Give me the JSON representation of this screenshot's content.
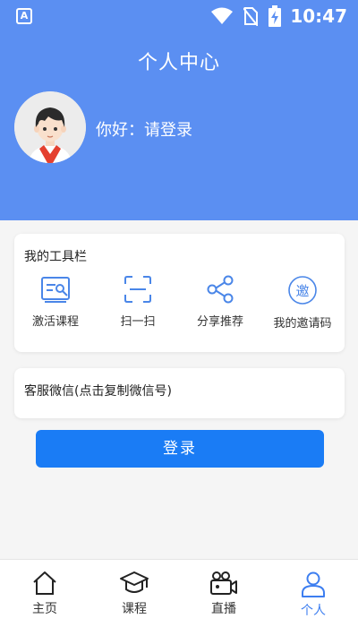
{
  "status_bar": {
    "time": "10:47",
    "app_icon_letter": "A"
  },
  "header": {
    "title": "个人中心",
    "greeting": "你好：请登录"
  },
  "toolbar": {
    "title": "我的工具栏",
    "items": [
      {
        "label": "激活课程",
        "icon": "activate-course-icon"
      },
      {
        "label": "扫一扫",
        "icon": "scan-icon"
      },
      {
        "label": "分享推荐",
        "icon": "share-icon"
      },
      {
        "label": "我的邀请码",
        "icon": "invite-code-icon"
      }
    ],
    "invite_glyph": "邀"
  },
  "service": {
    "label": "客服微信(点击复制微信号)"
  },
  "login_button": {
    "label": "登录"
  },
  "tabbar": {
    "items": [
      {
        "label": "主页",
        "icon": "home-icon"
      },
      {
        "label": "课程",
        "icon": "course-icon"
      },
      {
        "label": "直播",
        "icon": "live-icon"
      },
      {
        "label": "个人",
        "icon": "person-icon",
        "active": true
      }
    ]
  },
  "colors": {
    "header": "#5b8ff2",
    "accent": "#1a7cf5",
    "tab_active": "#3d7ef0",
    "tool_icon": "#4a86e8"
  }
}
